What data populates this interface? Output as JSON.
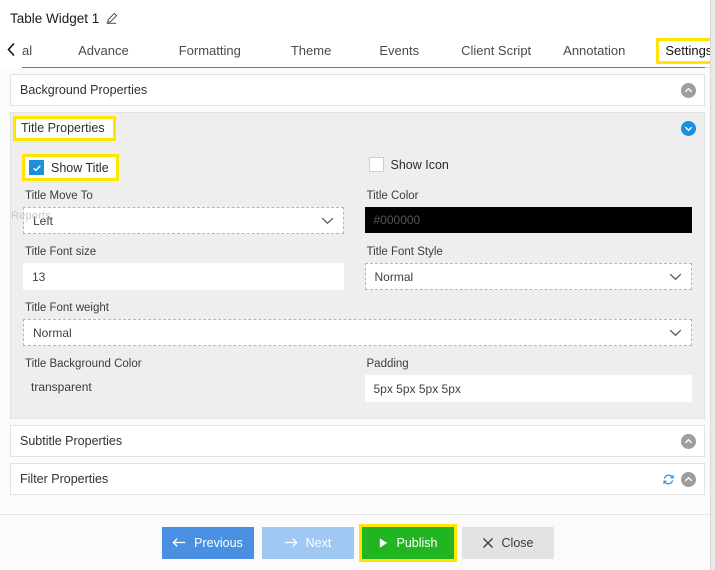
{
  "header": {
    "widget_title": "Table Widget 1",
    "edit_icon": "pencil-edit-icon"
  },
  "tabs": {
    "scroll_left_icon": "chevron-left-icon",
    "items": [
      {
        "label": "al",
        "active": false,
        "truncated": true
      },
      {
        "label": "Advance",
        "active": false
      },
      {
        "label": "Formatting",
        "active": false
      },
      {
        "label": "Theme",
        "active": false
      },
      {
        "label": "Events",
        "active": false
      },
      {
        "label": "Client Script",
        "active": false
      },
      {
        "label": "Annotation",
        "active": false
      },
      {
        "label": "Settings",
        "active": true,
        "highlighted": true
      }
    ]
  },
  "panels": [
    {
      "title": "Background Properties",
      "expanded": false,
      "collapse_icon": "chevron-up-circle-icon"
    },
    {
      "title": "Title Properties",
      "expanded": true,
      "highlighted": true,
      "collapse_icon": "chevron-down-circle-icon",
      "ghost_label": "Reports"
    },
    {
      "title": "Subtitle Properties",
      "expanded": false,
      "collapse_icon": "chevron-up-circle-icon"
    },
    {
      "title": "Filter Properties",
      "expanded": false,
      "refresh_icon": "refresh-sync-icon",
      "collapse_icon": "chevron-up-circle-icon"
    }
  ],
  "title_properties": {
    "show_title": {
      "label": "Show Title",
      "checked": true,
      "highlighted": true
    },
    "show_icon": {
      "label": "Show Icon",
      "checked": false
    },
    "title_move_to": {
      "label": "Title Move To",
      "value": "Left"
    },
    "title_color": {
      "label": "Title Color",
      "value": "#000000",
      "swatch": "#000000"
    },
    "title_font_size": {
      "label": "Title Font size",
      "value": "13"
    },
    "title_font_style": {
      "label": "Title Font Style",
      "value": "Normal"
    },
    "title_font_weight": {
      "label": "Title Font weight",
      "value": "Normal"
    },
    "title_background_color": {
      "label": "Title Background Color",
      "value": "transparent"
    },
    "padding": {
      "label": "Padding",
      "value": "5px 5px 5px 5px"
    }
  },
  "footer": {
    "previous": {
      "label": "Previous",
      "icon": "arrow-left-icon"
    },
    "next": {
      "label": "Next",
      "icon": "arrow-right-icon"
    },
    "publish": {
      "label": "Publish",
      "icon": "play-triangle-icon",
      "highlighted": true
    },
    "close": {
      "label": "Close",
      "icon": "close-x-icon"
    }
  },
  "colors": {
    "accent_blue": "#1a8fdd",
    "highlight_yellow": "#ffe500",
    "publish_green": "#22b522",
    "previous_blue": "#4a90e2",
    "next_blue": "#9fc8f2"
  }
}
